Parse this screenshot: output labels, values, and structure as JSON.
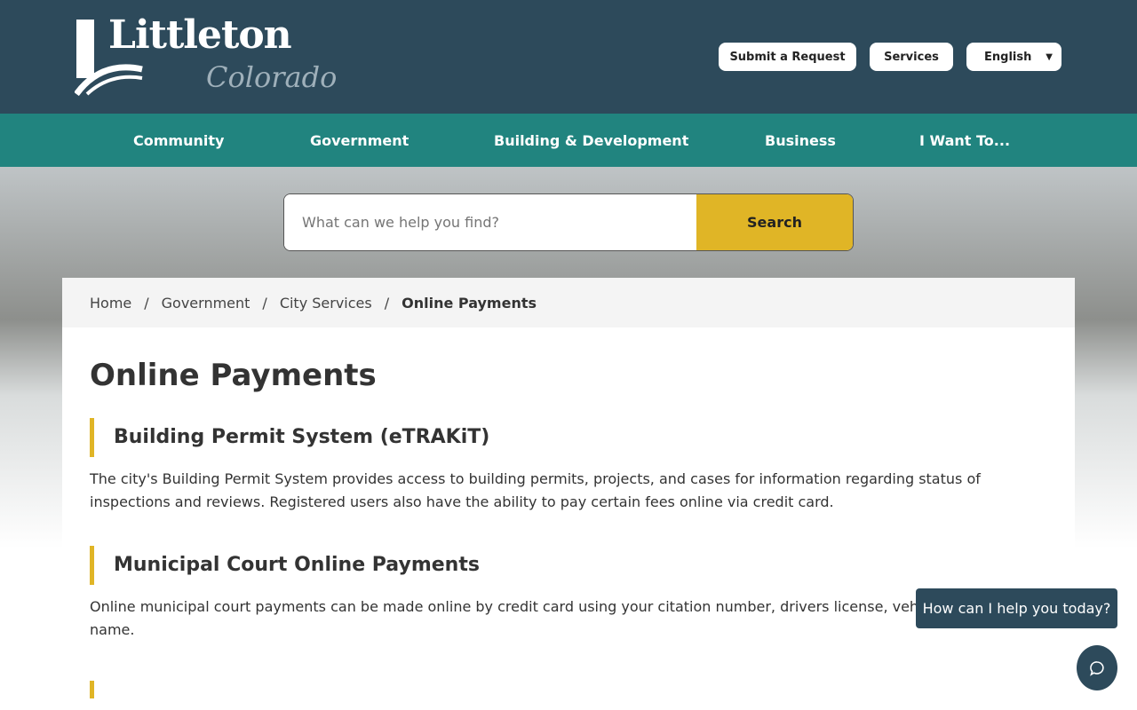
{
  "logo": {
    "title": "Littleton",
    "subtitle": "Colorado"
  },
  "header": {
    "submit": "Submit a Request",
    "services": "Services",
    "language": "English"
  },
  "nav": [
    "Community",
    "Government",
    "Building & Development",
    "Business",
    "I Want To..."
  ],
  "search": {
    "placeholder": "What can we help you find?",
    "button": "Search"
  },
  "breadcrumb": [
    "Home",
    "Government",
    "City Services",
    "Online Payments"
  ],
  "page": {
    "title": "Online Payments",
    "sections": [
      {
        "heading": "Building Permit System (eTRAKiT)",
        "text": "The city's Building Permit System provides access to building permits, projects, and cases for information regarding status of inspections and reviews. Registered users also have the ability to pay certain fees online via credit card."
      },
      {
        "heading": "Municipal Court Online Payments",
        "text": "Online municipal court payments can be made online by credit card using your citation number, drivers license, vehicle information, or name."
      }
    ]
  },
  "chat": {
    "prompt": "How can I help you today?"
  }
}
